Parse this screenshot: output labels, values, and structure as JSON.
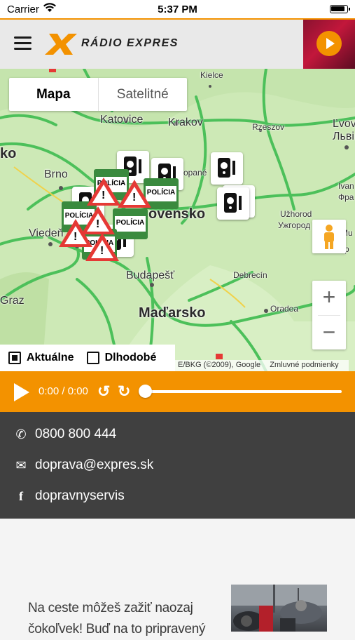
{
  "status_bar": {
    "carrier": "Carrier",
    "time": "5:37 PM"
  },
  "header": {
    "brand": "RÁDIO EXPRES",
    "brand_mark": "X"
  },
  "map": {
    "type_control": {
      "map_label": "Mapa",
      "satellite_label": "Satelitné",
      "active": "Mapa"
    },
    "labels": [
      {
        "text": "Kielce",
        "cls": "small"
      },
      {
        "text": "Katovice",
        "cls": "mid"
      },
      {
        "text": "Krakov",
        "cls": "mid"
      },
      {
        "text": "Rzeszov",
        "cls": "small"
      },
      {
        "text": "Ľvov",
        "cls": "mid"
      },
      {
        "text": "Львів",
        "cls": "mid"
      },
      {
        "text": "Brno",
        "cls": "mid"
      },
      {
        "text": "Viedeň",
        "cls": "mid"
      },
      {
        "text": "ovensko",
        "cls": "big"
      },
      {
        "text": "Užhorod",
        "cls": "small"
      },
      {
        "text": "Ужгород",
        "cls": "small"
      },
      {
        "text": "Budapešť",
        "cls": "mid"
      },
      {
        "text": "Maďarsko",
        "cls": "big"
      },
      {
        "text": "Debrecín",
        "cls": "small"
      },
      {
        "text": "Oradea",
        "cls": "small"
      },
      {
        "text": "Graz",
        "cls": "mid"
      },
      {
        "text": "ko",
        "cls": "big"
      },
      {
        "text": "Ivan",
        "cls": "small"
      },
      {
        "text": "Фра",
        "cls": "small"
      },
      {
        "text": "Mu",
        "cls": "small"
      },
      {
        "text": "opané",
        "cls": "small"
      },
      {
        "text": "Chop",
        "cls": "small"
      }
    ],
    "police_label": "POLÍCIA",
    "filters": {
      "current_label": "Aktuálne",
      "current_checked": true,
      "longterm_label": "Dlhodobé",
      "longterm_checked": false
    },
    "attribution": {
      "copyright": "E/BKG (©2009), Google",
      "terms": "Zmluvné podmienky"
    },
    "zoom": {
      "in": "+",
      "out": "−"
    }
  },
  "player": {
    "time": "0:00 / 0:00",
    "progress": 0
  },
  "contact": {
    "phone": "0800 800 444",
    "email": "doprava@expres.sk",
    "facebook": "dopravnyservis"
  },
  "article": {
    "headline": "Na ceste môžeš zažiť naozaj čokoľvek! Buď na to pripravený"
  },
  "colors": {
    "accent": "#f39200",
    "police_green": "#3a8a3e",
    "dark": "#404040"
  }
}
